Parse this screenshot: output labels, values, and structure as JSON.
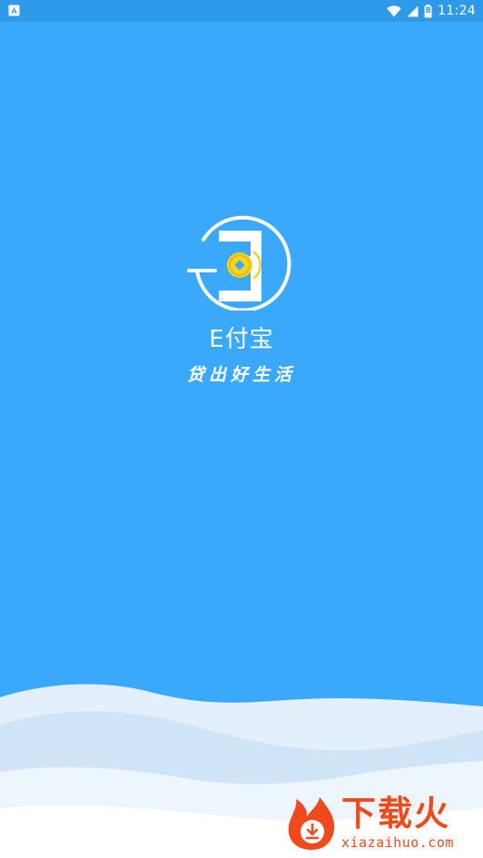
{
  "status_bar": {
    "time": "11:24",
    "battery_level": "8",
    "icons": [
      "notification-a-icon",
      "wifi-icon",
      "signal-icon",
      "battery-icon"
    ]
  },
  "splash": {
    "brand_name": "E付宝",
    "slogan": "贷出好生活",
    "background_color": "#3aa8fb",
    "coin_color": "#f5d320"
  },
  "watermark": {
    "title": "下载火",
    "url": "xiazaihuo.com",
    "color": "#f04a1c"
  }
}
